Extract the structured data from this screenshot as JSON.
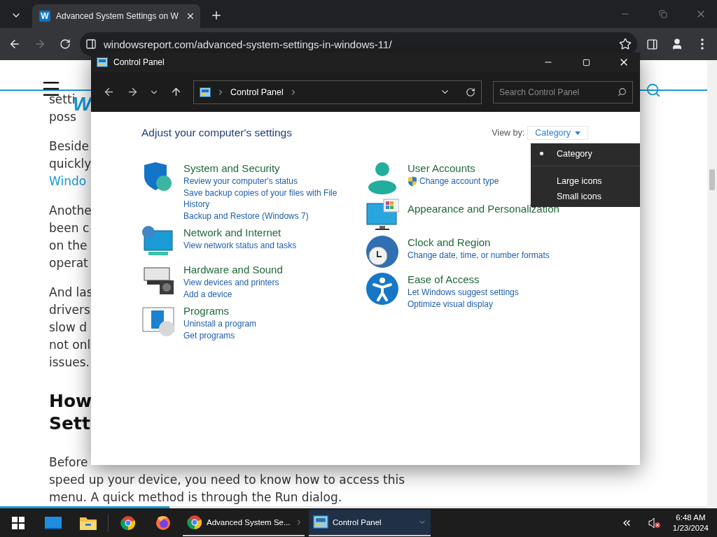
{
  "browser": {
    "tab": {
      "favicon": "W",
      "title": "Advanced System Settings on W"
    },
    "url": "windowsreport.com/advanced-system-settings-in-windows-11/"
  },
  "site": {
    "logo": "W",
    "reading_progress": {
      "level": 0.24
    }
  },
  "article": [
    {
      "kind": "paragraph",
      "lines": [
        {
          "text": "setti",
          "link": false
        },
        {
          "text": "poss",
          "link": false
        }
      ]
    },
    {
      "kind": "paragraph",
      "lines": [
        {
          "text": "Beside",
          "link": false
        },
        {
          "text": "quickly",
          "link": false
        },
        {
          "text": "Windo",
          "link": true
        }
      ]
    },
    {
      "kind": "paragraph",
      "lines": [
        {
          "text": "Anothe",
          "link": false
        },
        {
          "text": "been c",
          "link": false
        },
        {
          "text": "on the",
          "link": false
        },
        {
          "text": "operat",
          "link": false
        }
      ]
    },
    {
      "kind": "paragraph",
      "lines": [
        {
          "text": "And las",
          "link": false
        },
        {
          "text": "drivers",
          "link": false
        },
        {
          "text": "slow d",
          "link": false
        },
        {
          "text": "not onl",
          "link": false
        },
        {
          "text": "issues.",
          "link": false
        }
      ]
    },
    {
      "kind": "heading",
      "lines": [
        {
          "text": "How",
          "link": false
        },
        {
          "text": "Sett",
          "link": false
        }
      ]
    },
    {
      "kind": "paragraph",
      "lines": [
        {
          "text": "Before",
          "link": false
        },
        {
          "text": "speed up your device, you need to know how to access this",
          "link": false
        },
        {
          "text": "menu. A quick method is through the Run dialog.",
          "link": false
        }
      ]
    }
  ],
  "control_panel": {
    "title": "Control Panel",
    "breadcrumb": [
      "Control Panel"
    ],
    "search": {
      "placeholder": "Search Control Panel"
    },
    "heading": "Adjust your computer's settings",
    "view_by": {
      "label": "View by:",
      "value": "Category",
      "menu": [
        {
          "label": "Category",
          "selected": true
        },
        {
          "label": "Large icons",
          "selected": false
        },
        {
          "label": "Small icons",
          "selected": false
        }
      ]
    },
    "columns": [
      [
        {
          "kind": "security",
          "title": "System and Security",
          "links": [
            {
              "text": "Review your computer's status",
              "shield": false
            },
            {
              "text": "Save backup copies of your files with File History",
              "shield": false
            },
            {
              "text": "Backup and Restore (Windows 7)",
              "shield": false
            }
          ]
        },
        {
          "kind": "network",
          "title": "Network and Internet",
          "links": [
            {
              "text": "View network status and tasks",
              "shield": false
            }
          ]
        },
        {
          "kind": "hardware",
          "title": "Hardware and Sound",
          "links": [
            {
              "text": "View devices and printers",
              "shield": false
            },
            {
              "text": "Add a device",
              "shield": false
            }
          ]
        },
        {
          "kind": "programs",
          "title": "Programs",
          "links": [
            {
              "text": "Uninstall a program",
              "shield": false
            },
            {
              "text": "Get programs",
              "shield": false
            }
          ]
        }
      ],
      [
        {
          "kind": "users",
          "title": "User Accounts",
          "links": [
            {
              "text": "Change account type",
              "shield": true
            }
          ]
        },
        {
          "kind": "appearance",
          "title": "Appearance and Personalization"
        },
        {
          "kind": "clock",
          "title": "Clock and Region",
          "links": [
            {
              "text": "Change date, time, or number formats",
              "shield": false
            }
          ]
        },
        {
          "kind": "access",
          "title": "Ease of Access",
          "links": [
            {
              "text": "Let Windows suggest settings",
              "shield": false
            },
            {
              "text": "Optimize visual display",
              "shield": false
            }
          ]
        }
      ]
    ]
  },
  "taskbar": {
    "apps": [
      {
        "kind": "chrome",
        "label": "Advanced System Se...",
        "selected": false
      },
      {
        "kind": "control-panel",
        "label": "Control Panel",
        "selected": true
      }
    ],
    "clock": {
      "time": "6:48 AM",
      "date": "1/23/2024"
    }
  }
}
